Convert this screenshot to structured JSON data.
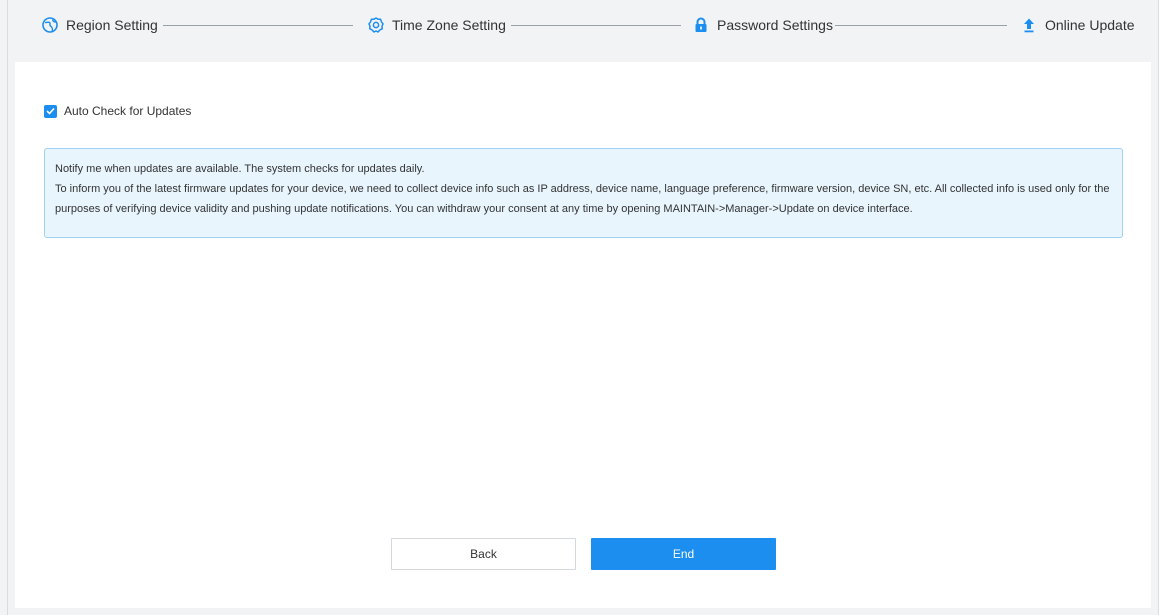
{
  "steps": [
    {
      "label": "Region Setting",
      "icon": "globe-icon"
    },
    {
      "label": "Time Zone Setting",
      "icon": "gear-clock-icon"
    },
    {
      "label": "Password Settings",
      "icon": "lock-icon"
    },
    {
      "label": "Online Update",
      "icon": "upload-arrow-icon"
    }
  ],
  "auto_check": {
    "label": "Auto Check for Updates",
    "checked": true
  },
  "notice": {
    "line1": "Notify me when updates are available. The system checks for updates daily.",
    "line2": "To inform you of the latest firmware updates for your device, we need to collect device info such as IP address, device name, language preference, firmware version, device SN, etc. All collected info is used only for the purposes of verifying device validity and pushing update notifications. You can withdraw your consent at any time by opening MAINTAIN->Manager->Update on device interface."
  },
  "buttons": {
    "back": "Back",
    "end": "End"
  },
  "colors": {
    "accent": "#1c8ef0",
    "notice_bg": "#e8f5fd",
    "notice_border": "#9fd2f3"
  }
}
